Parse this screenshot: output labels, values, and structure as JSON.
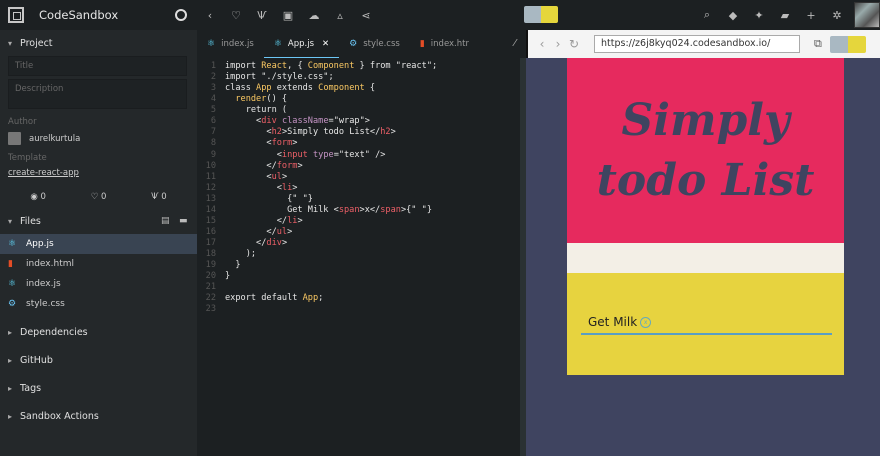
{
  "app": {
    "name": "CodeSandbox"
  },
  "toolbar": {
    "toggle_colors": [
      "#a9b8c2",
      "#e5d63c"
    ]
  },
  "sidebar": {
    "project": "Project",
    "title_placeholder": "Title",
    "description_placeholder": "Description",
    "author_label": "Author",
    "author": "aurelkurtula",
    "template_label": "Template",
    "template": "create-react-app",
    "stats": {
      "views": "0",
      "likes": "0",
      "forks": "0"
    },
    "files_label": "Files",
    "files": [
      {
        "name": "App.js",
        "icon": "react-icon"
      },
      {
        "name": "index.html",
        "icon": "html5-icon"
      },
      {
        "name": "index.js",
        "icon": "react-icon"
      },
      {
        "name": "style.css",
        "icon": "css-icon"
      }
    ],
    "sections": [
      "Dependencies",
      "GitHub",
      "Tags",
      "Sandbox Actions"
    ]
  },
  "editor": {
    "tabs": [
      {
        "name": "index.js",
        "icon": "react-icon"
      },
      {
        "name": "App.js",
        "icon": "react-icon"
      },
      {
        "name": "style.css",
        "icon": "css-icon"
      },
      {
        "name": "index.htr",
        "icon": "html5-icon"
      }
    ],
    "lines": [
      "import React, { Component } from \"react\";",
      "import \"./style.css\";",
      "class App extends Component {",
      "  render() {",
      "    return (",
      "      <div className=\"wrap\">",
      "        <h2>Simply todo List</h2>",
      "        <form>",
      "          <input type=\"text\" />",
      "        </form>",
      "        <ul>",
      "          <li>",
      "            {\" \"}",
      "            Get Milk <span>x</span>{\" \"}",
      "          </li>",
      "        </ul>",
      "      </div>",
      "    );",
      "  }",
      "}",
      "",
      "export default App;",
      ""
    ]
  },
  "preview": {
    "url": "https://z6j8kyq024.codesandbox.io/",
    "heading": "Simply todo List",
    "item": "Get Milk",
    "colors": {
      "hero": "#e62a5e",
      "list": "#e7d33f",
      "bg": "#3f4460"
    }
  }
}
